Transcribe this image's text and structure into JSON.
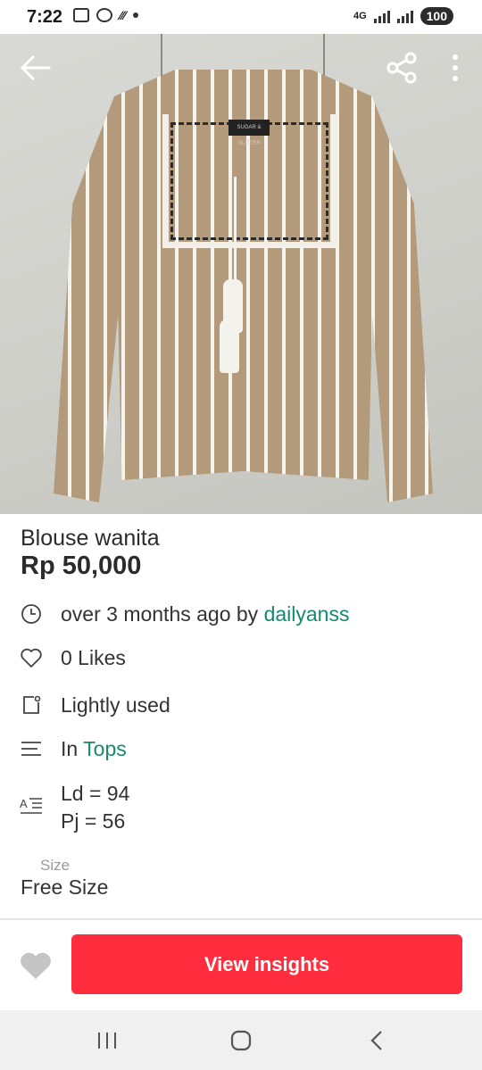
{
  "status_bar": {
    "time": "7:22",
    "network": "4G",
    "battery": "100"
  },
  "product": {
    "title": "Blouse wanita",
    "price": "Rp 50,000",
    "image_label": "SUGAR & GLITTER"
  },
  "details": {
    "posted": {
      "prefix": "over 3 months ago by ",
      "seller": "dailyanss"
    },
    "likes": "0 Likes",
    "condition": "Lightly used",
    "category": {
      "prefix": "In ",
      "name": "Tops"
    },
    "description_lines": [
      "Ld = 94",
      "Pj = 56"
    ],
    "size": {
      "label": "Size",
      "value": "Free Size"
    }
  },
  "actions": {
    "insights_label": "View insights"
  },
  "colors": {
    "accent_green": "#148a6f",
    "cta_red": "#ff2d3d"
  },
  "icons": [
    "back-arrow-icon",
    "share-icon",
    "more-vert-icon",
    "clock-icon",
    "heart-outline-icon",
    "condition-icon",
    "category-list-icon",
    "description-icon",
    "heart-filled-icon",
    "recents-icon",
    "home-icon",
    "nav-back-icon"
  ]
}
